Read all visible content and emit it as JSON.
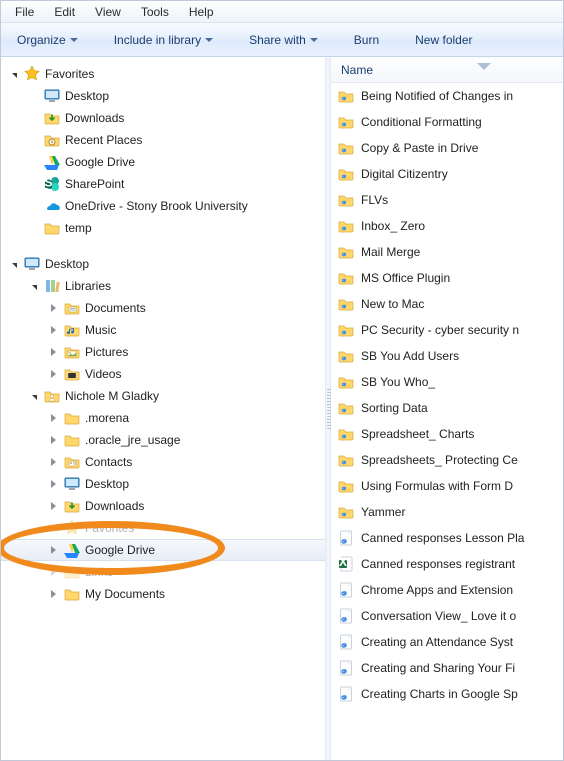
{
  "menubar": {
    "items": [
      "File",
      "Edit",
      "View",
      "Tools",
      "Help"
    ]
  },
  "toolbar": {
    "organize": "Organize",
    "include": "Include in library",
    "share": "Share with",
    "burn": "Burn",
    "newfolder": "New folder"
  },
  "columns": {
    "name": "Name"
  },
  "nav": {
    "favorites": {
      "label": "Favorites",
      "children": [
        {
          "icon": "desktop",
          "label": "Desktop"
        },
        {
          "icon": "downloads",
          "label": "Downloads"
        },
        {
          "icon": "recent",
          "label": "Recent Places"
        },
        {
          "icon": "gdrive",
          "label": "Google Drive"
        },
        {
          "icon": "sharepoint",
          "label": "SharePoint"
        },
        {
          "icon": "onedrive",
          "label": "OneDrive - Stony Brook University"
        },
        {
          "icon": "folder",
          "label": "temp"
        }
      ]
    },
    "desktop": {
      "label": "Desktop",
      "libraries": {
        "label": "Libraries",
        "children": [
          {
            "icon": "lib-doc",
            "label": "Documents"
          },
          {
            "icon": "lib-music",
            "label": "Music"
          },
          {
            "icon": "lib-pic",
            "label": "Pictures"
          },
          {
            "icon": "lib-vid",
            "label": "Videos"
          }
        ]
      },
      "user": {
        "label": "Nichole M Gladky",
        "children": [
          {
            "icon": "folder",
            "label": ".morena"
          },
          {
            "icon": "folder",
            "label": ".oracle_jre_usage"
          },
          {
            "icon": "contacts",
            "label": "Contacts"
          },
          {
            "icon": "desktop",
            "label": "Desktop"
          },
          {
            "icon": "downloads",
            "label": "Downloads"
          },
          {
            "icon": "favorites-folder",
            "label": "Favorites",
            "hidden_row": true
          },
          {
            "icon": "gdrive",
            "label": "Google Drive",
            "selected": true
          },
          {
            "icon": "folder",
            "label": "Links",
            "hidden_row": true
          },
          {
            "icon": "folder",
            "label": "My Documents"
          }
        ]
      }
    }
  },
  "files": [
    {
      "icon": "gfolder",
      "label": "Being Notified of Changes in"
    },
    {
      "icon": "gfolder",
      "label": "Conditional Formatting"
    },
    {
      "icon": "gfolder",
      "label": "Copy & Paste in Drive"
    },
    {
      "icon": "gfolder",
      "label": "Digital Citizentry"
    },
    {
      "icon": "gfolder",
      "label": "FLVs"
    },
    {
      "icon": "gfolder",
      "label": "Inbox_ Zero"
    },
    {
      "icon": "gfolder",
      "label": "Mail Merge"
    },
    {
      "icon": "gfolder",
      "label": "MS Office Plugin"
    },
    {
      "icon": "gfolder",
      "label": "New to Mac"
    },
    {
      "icon": "gfolder",
      "label": "PC Security - cyber security n"
    },
    {
      "icon": "gfolder",
      "label": "SB You Add Users"
    },
    {
      "icon": "gfolder",
      "label": "SB You Who_"
    },
    {
      "icon": "gfolder",
      "label": "Sorting Data"
    },
    {
      "icon": "gfolder",
      "label": "Spreadsheet_ Charts"
    },
    {
      "icon": "gfolder",
      "label": "Spreadsheets_ Protecting Ce"
    },
    {
      "icon": "gfolder",
      "label": "Using Formulas with Form D"
    },
    {
      "icon": "gfolder",
      "label": "Yammer"
    },
    {
      "icon": "gdoc",
      "label": "Canned responses Lesson Pla"
    },
    {
      "icon": "excel",
      "label": "Canned responses registrant"
    },
    {
      "icon": "gdoc",
      "label": "Chrome Apps and Extension"
    },
    {
      "icon": "gdoc",
      "label": "Conversation View_ Love it o"
    },
    {
      "icon": "gdoc",
      "label": "Creating an Attendance Syst"
    },
    {
      "icon": "gdoc",
      "label": "Creating and Sharing Your Fi"
    },
    {
      "icon": "gdoc",
      "label": "Creating Charts in Google Sp"
    }
  ]
}
